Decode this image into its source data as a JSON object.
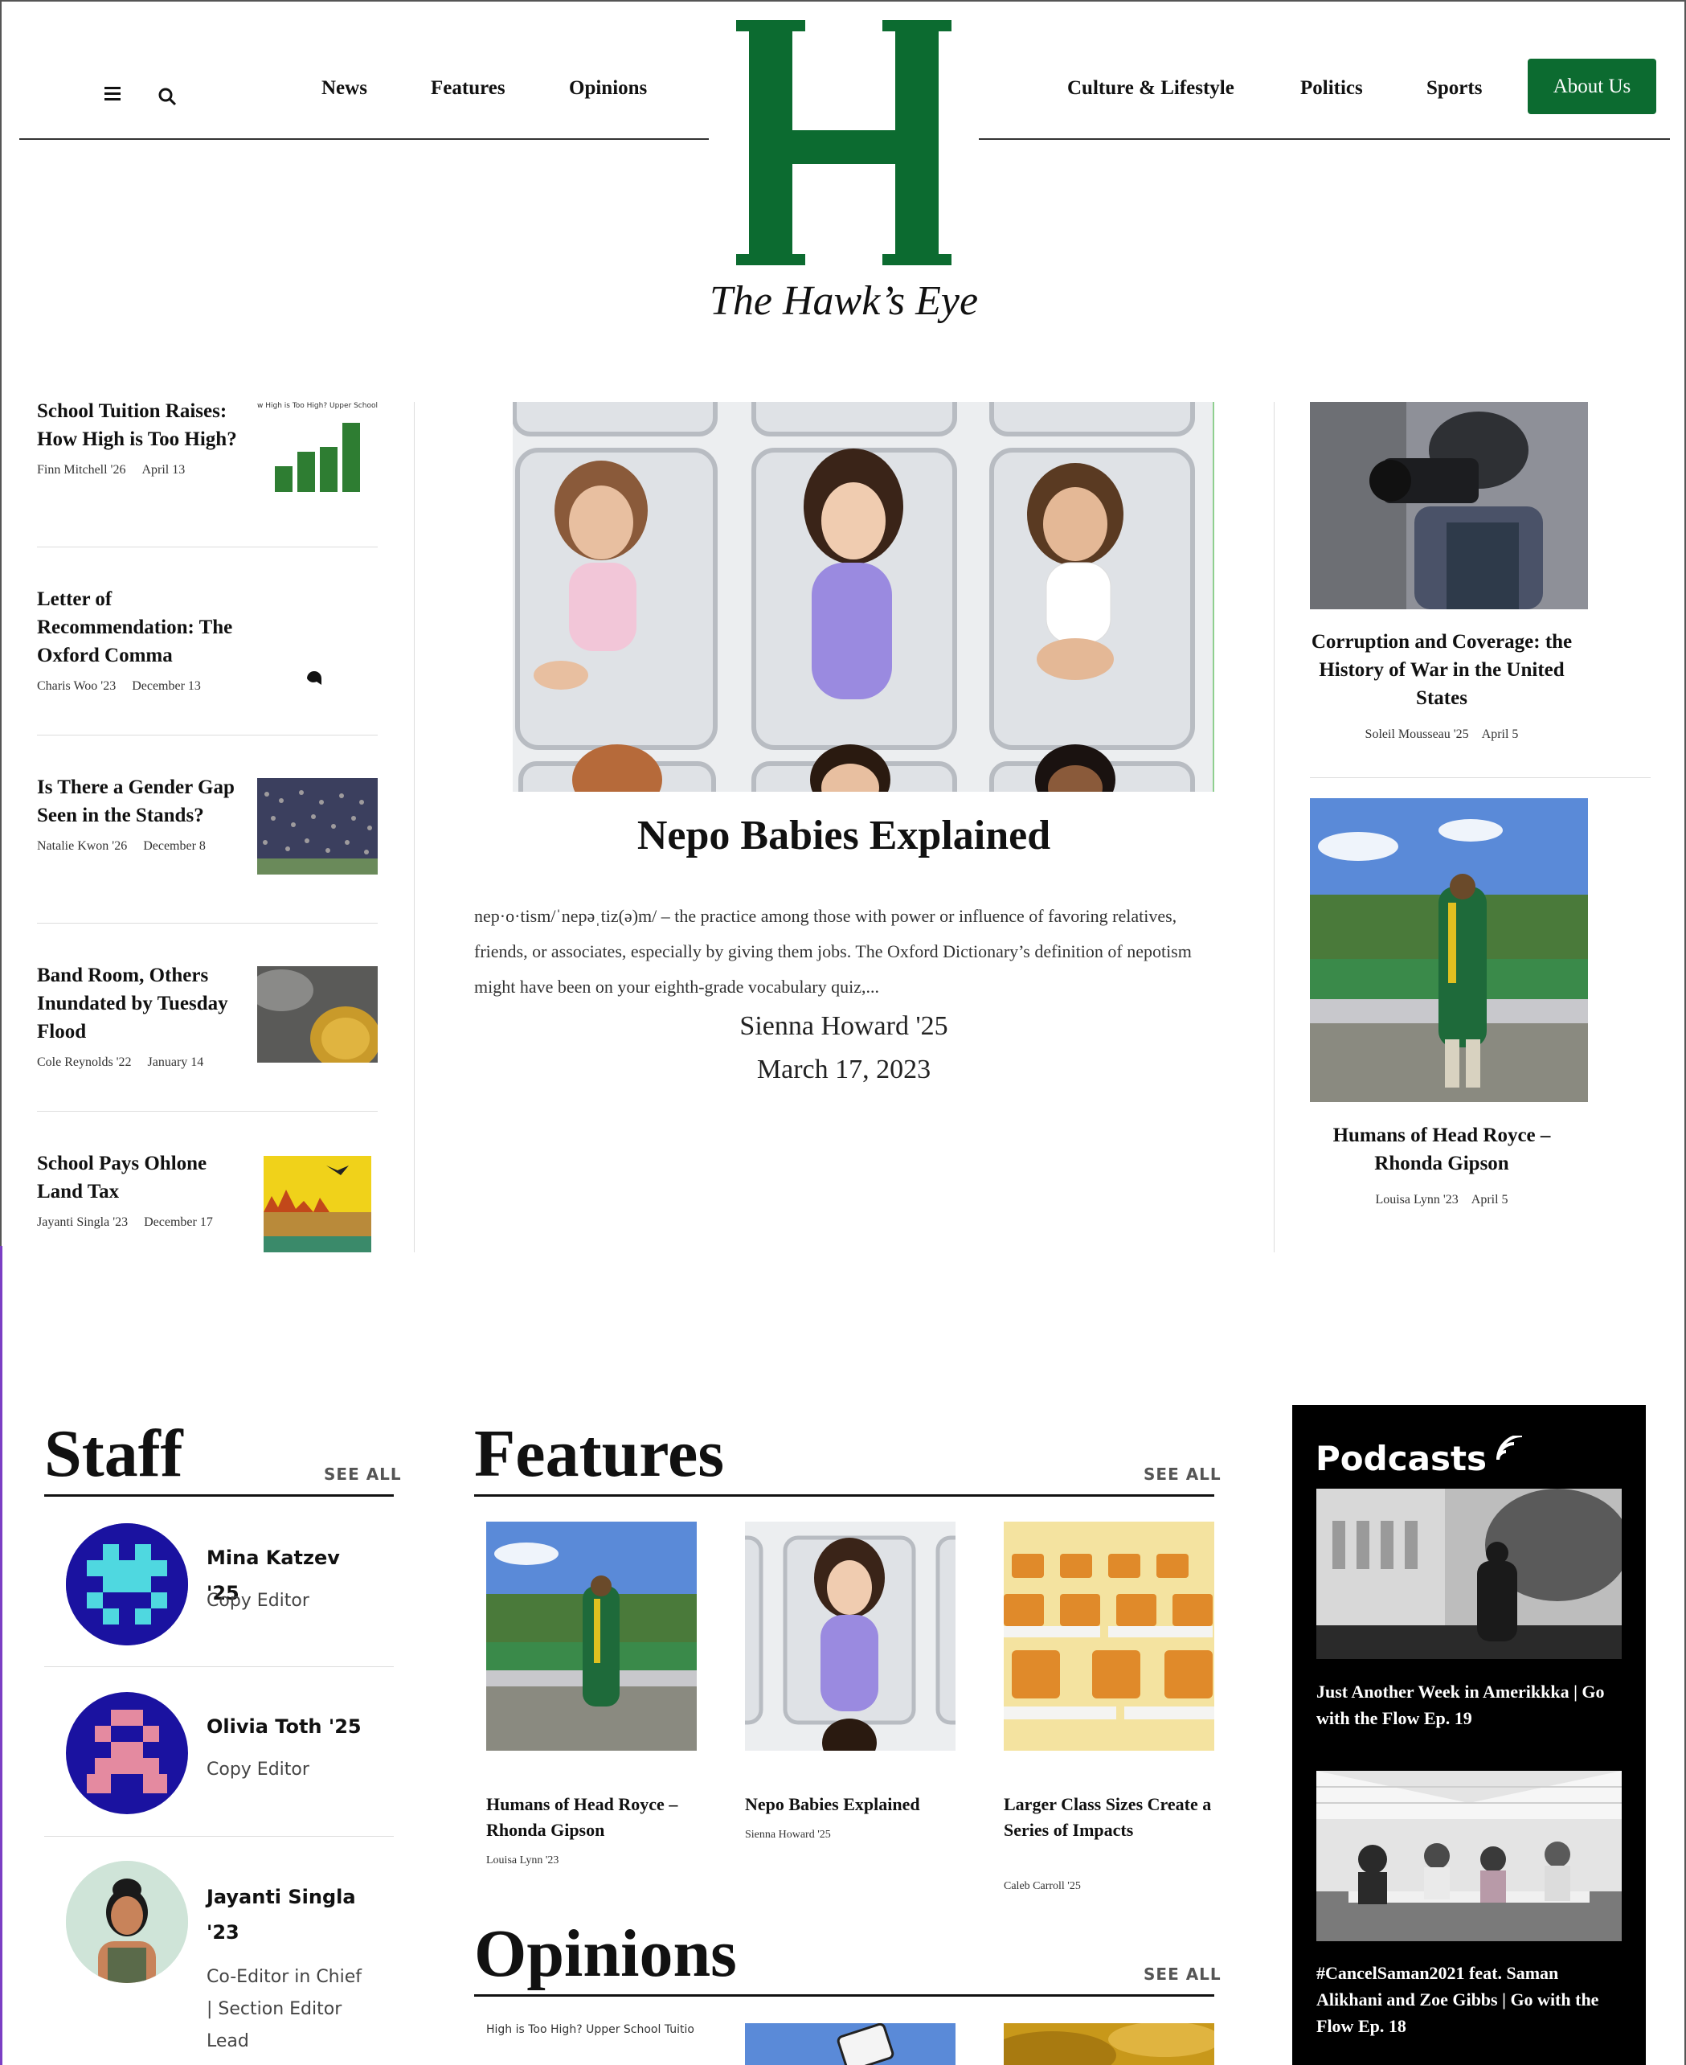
{
  "nav": {
    "left": [
      "News",
      "Features",
      "Opinions"
    ],
    "right": [
      "Culture & Lifestyle",
      "Politics",
      "Sports"
    ],
    "about": "About Us"
  },
  "brand": {
    "letter": "H",
    "tagline": "The Hawk’s Eye",
    "color": "#0c6b30"
  },
  "left_articles": [
    {
      "title": "School Tuition Raises: How High is Too High?",
      "author": "Finn Mitchell '26",
      "date": "April 13",
      "thumb_caption": "w High is Too High? Upper School Tuitio"
    },
    {
      "title": "Letter of Recommendation: The Oxford Comma",
      "author": "Charis Woo '23",
      "date": "December 13"
    },
    {
      "title": "Is There a Gender Gap Seen in the Stands?",
      "author": "Natalie Kwon '26",
      "date": "December 8"
    },
    {
      "title": "Band Room, Others Inundated by Tuesday Flood",
      "author": "Cole Reynolds '22",
      "date": "January 14"
    },
    {
      "title": "School Pays Ohlone Land Tax",
      "author": "Jayanti Singla '23",
      "date": "December 17"
    }
  ],
  "hero": {
    "title": "Nepo Babies Explained",
    "excerpt": "nep·o·tism/ˈnepəˌtiz(ə)m/ – the practice among those with power or influence of favoring relatives, friends, or associates, especially by giving them jobs.  The Oxford Dictionary’s definition of nepotism might have been on your eighth-grade vocabulary quiz,...",
    "author": "Sienna Howard '25",
    "date": "March 17, 2023"
  },
  "right_articles": [
    {
      "title": "Corruption and Coverage: the History of War in the United States",
      "author": "Soleil Mousseau '25",
      "date": "April 5"
    },
    {
      "title": "Humans of Head Royce – Rhonda Gipson",
      "author": "Louisa Lynn '23",
      "date": "April 5"
    }
  ],
  "staff": {
    "heading": "Staff",
    "see_all": "SEE ALL",
    "members": [
      {
        "name": "Mina Katzev '25",
        "role": "Copy Editor"
      },
      {
        "name": "Olivia Toth '25",
        "role": "Copy Editor"
      },
      {
        "name": "Jayanti Singla '23",
        "role": "Co-Editor in Chief | Section Editor Lead"
      }
    ]
  },
  "features": {
    "heading": "Features",
    "see_all": "SEE ALL",
    "items": [
      {
        "title": "Humans of Head Royce – Rhonda Gipson",
        "author": "Louisa Lynn '23"
      },
      {
        "title": "Nepo Babies Explained",
        "author": "Sienna Howard '25"
      },
      {
        "title": "Larger Class Sizes Create a Series of Impacts",
        "author": "Caleb Carroll '25"
      }
    ]
  },
  "opinions": {
    "heading": "Opinions",
    "see_all": "SEE ALL",
    "thumb_caption": "High is Too High? Upper School Tuitio"
  },
  "podcasts": {
    "heading": "Podcasts",
    "items": [
      {
        "title": "Just Another Week in Amerikkka | Go with the Flow Ep. 19"
      },
      {
        "title": "#CancelSaman2021 feat. Saman Alikhani and Zoe Gibbs | Go with the Flow Ep. 18"
      }
    ]
  }
}
